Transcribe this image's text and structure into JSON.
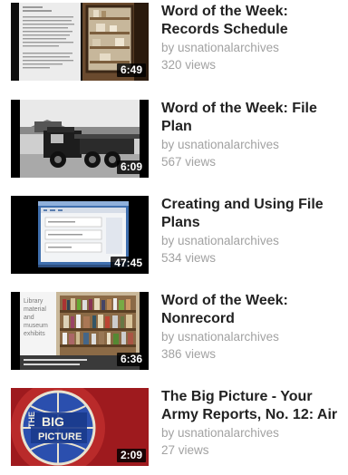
{
  "videos": [
    {
      "title_lines": [
        "Word of the Week:",
        "Records Schedule"
      ],
      "channel": "by usnationalarchives",
      "views": "320 views",
      "duration": "6:49",
      "thumb_icon": "document-page-thumbnail"
    },
    {
      "title_lines": [
        "Word of the Week: File",
        "Plan"
      ],
      "channel": "by usnationalarchives",
      "views": "567 views",
      "duration": "6:09",
      "thumb_icon": "vintage-truck-thumbnail"
    },
    {
      "title_lines": [
        "Creating and Using File",
        "Plans"
      ],
      "channel": "by usnationalarchives",
      "views": "534 views",
      "duration": "47:45",
      "thumb_icon": "computer-screen-thumbnail"
    },
    {
      "title_lines": [
        "Word of the Week:",
        "Nonrecord"
      ],
      "channel": "by usnationalarchives",
      "views": "386 views",
      "duration": "6:36",
      "thumb_icon": "library-shelves-thumbnail",
      "thumb_text": [
        "Library",
        "material",
        "and",
        "museum",
        "exhibits"
      ]
    },
    {
      "title_lines": [
        "The Big Picture - Your",
        "Army Reports, No. 12: Air"
      ],
      "channel": "by usnationalarchives",
      "views": "27 views",
      "duration": "2:09",
      "thumb_icon": "big-picture-logo-thumbnail",
      "thumb_text": [
        "THE",
        "BIG",
        "PICTURE"
      ]
    }
  ]
}
